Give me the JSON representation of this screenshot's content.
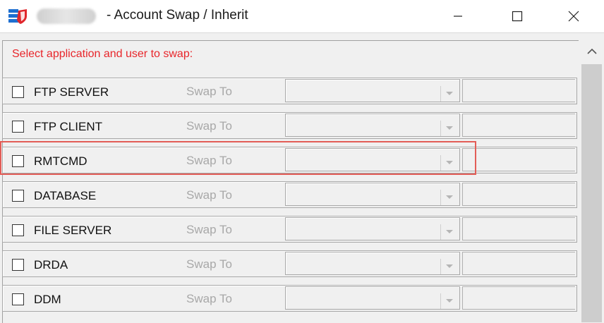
{
  "window": {
    "title": "- Account Swap / Inherit",
    "icons": {
      "app": "shield-server-icon",
      "minimize": "minimize-icon",
      "maximize": "maximize-icon",
      "close": "close-icon"
    }
  },
  "instruction": "Select application and user to swap:",
  "swap_label": "Swap To",
  "rows": [
    {
      "label": "FTP SERVER",
      "checked": false,
      "selected_user": ""
    },
    {
      "label": "FTP CLIENT",
      "checked": false,
      "selected_user": ""
    },
    {
      "label": "RMTCMD",
      "checked": false,
      "selected_user": ""
    },
    {
      "label": "DATABASE",
      "checked": false,
      "selected_user": ""
    },
    {
      "label": "FILE SERVER",
      "checked": false,
      "selected_user": ""
    },
    {
      "label": "DRDA",
      "checked": false,
      "selected_user": ""
    },
    {
      "label": "DDM",
      "checked": false,
      "selected_user": ""
    }
  ],
  "colors": {
    "instruction": "#e8262b",
    "highlight": "#e35d57",
    "disabled_text": "#a8a8a8"
  }
}
